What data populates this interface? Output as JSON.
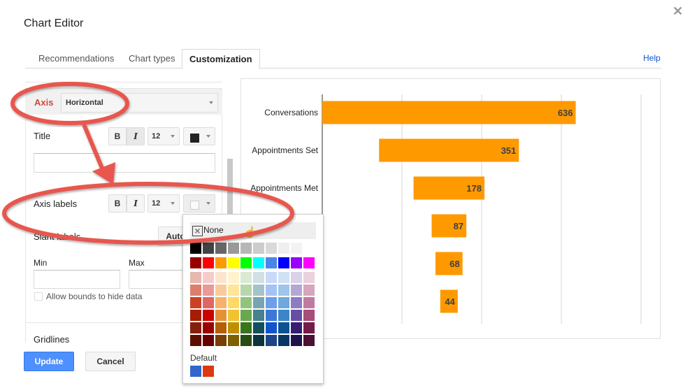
{
  "dialog": {
    "title": "Chart Editor",
    "close_icon": "close-icon"
  },
  "tabs": [
    {
      "label": "Recommendations",
      "active": false
    },
    {
      "label": "Chart types",
      "active": false
    },
    {
      "label": "Customization",
      "active": true
    }
  ],
  "help_label": "Help",
  "customization": {
    "axis_label": "Axis",
    "axis_select_value": "Horizontal",
    "title_row": {
      "label": "Title",
      "bold_label": "B",
      "italic_label": "I",
      "font_size": "12",
      "color": "#222222",
      "value": ""
    },
    "axis_labels_row": {
      "label": "Axis labels",
      "bold_label": "B",
      "italic_label": "I",
      "font_size": "12",
      "color": "none"
    },
    "slant_labels": {
      "label": "Slant labels",
      "button_label": "Auto"
    },
    "min_label": "Min",
    "max_label": "Max",
    "min_value": "",
    "max_value": "",
    "allow_bounds_label": "Allow bounds to hide data",
    "allow_bounds_checked": false,
    "gridlines_label": "Gridlines"
  },
  "buttons": {
    "update": "Update",
    "cancel": "Cancel"
  },
  "color_picker": {
    "none_label": "None",
    "default_label": "Default",
    "grays": [
      "#000000",
      "#434343",
      "#666666",
      "#999999",
      "#b7b7b7",
      "#cccccc",
      "#d9d9d9",
      "#efefef",
      "#f3f3f3",
      "#ffffff"
    ],
    "brights": [
      "#980000",
      "#ff0000",
      "#ff9900",
      "#ffff00",
      "#00ff00",
      "#00ffff",
      "#4a86e8",
      "#0000ff",
      "#9900ff",
      "#ff00ff"
    ],
    "shades": [
      [
        "#e6b8af",
        "#f4cccc",
        "#fce5cd",
        "#fff2cc",
        "#d9ead3",
        "#d0e0e3",
        "#c9daf8",
        "#cfe2f3",
        "#d9d2e9",
        "#ead1dc"
      ],
      [
        "#dd7e6b",
        "#ea9999",
        "#f9cb9c",
        "#ffe599",
        "#b6d7a8",
        "#a2c4c9",
        "#a4c2f4",
        "#9fc5e8",
        "#b4a7d6",
        "#d5a6bd"
      ],
      [
        "#cc4125",
        "#e06666",
        "#f6b26b",
        "#ffd966",
        "#93c47d",
        "#76a5af",
        "#6d9eeb",
        "#6fa8dc",
        "#8e7cc3",
        "#c27ba0"
      ],
      [
        "#a61c00",
        "#cc0000",
        "#e69138",
        "#f1c232",
        "#6aa84f",
        "#45818e",
        "#3c78d8",
        "#3d85c6",
        "#674ea7",
        "#a64d79"
      ],
      [
        "#85200c",
        "#990000",
        "#b45f06",
        "#bf9000",
        "#38761d",
        "#134f5c",
        "#1155cc",
        "#0b5394",
        "#351c75",
        "#741b47"
      ],
      [
        "#5b0f00",
        "#660000",
        "#783f04",
        "#7f6000",
        "#274e13",
        "#0c343d",
        "#1c4587",
        "#073763",
        "#20124d",
        "#4c1130"
      ]
    ],
    "defaults": [
      "#3366cc",
      "#dc3912"
    ]
  },
  "chart_data": {
    "type": "bar",
    "orientation": "horizontal",
    "style": "funnel (centered bars)",
    "categories": [
      "Conversations",
      "Appointments Set",
      "Appointments Met",
      "",
      "",
      ""
    ],
    "values": [
      636,
      351,
      178,
      87,
      68,
      44
    ],
    "data_labels": [
      "636",
      "351",
      "178",
      "87",
      "68",
      "44"
    ],
    "bar_color": "#ff9900",
    "title": "",
    "xlabel": "",
    "ylabel": "",
    "xlim": [
      0,
      800
    ],
    "grid": true,
    "gridline_count": 5,
    "x_tick_labels_visible": false,
    "legend": "none"
  },
  "annotation_color": "#e8574d"
}
